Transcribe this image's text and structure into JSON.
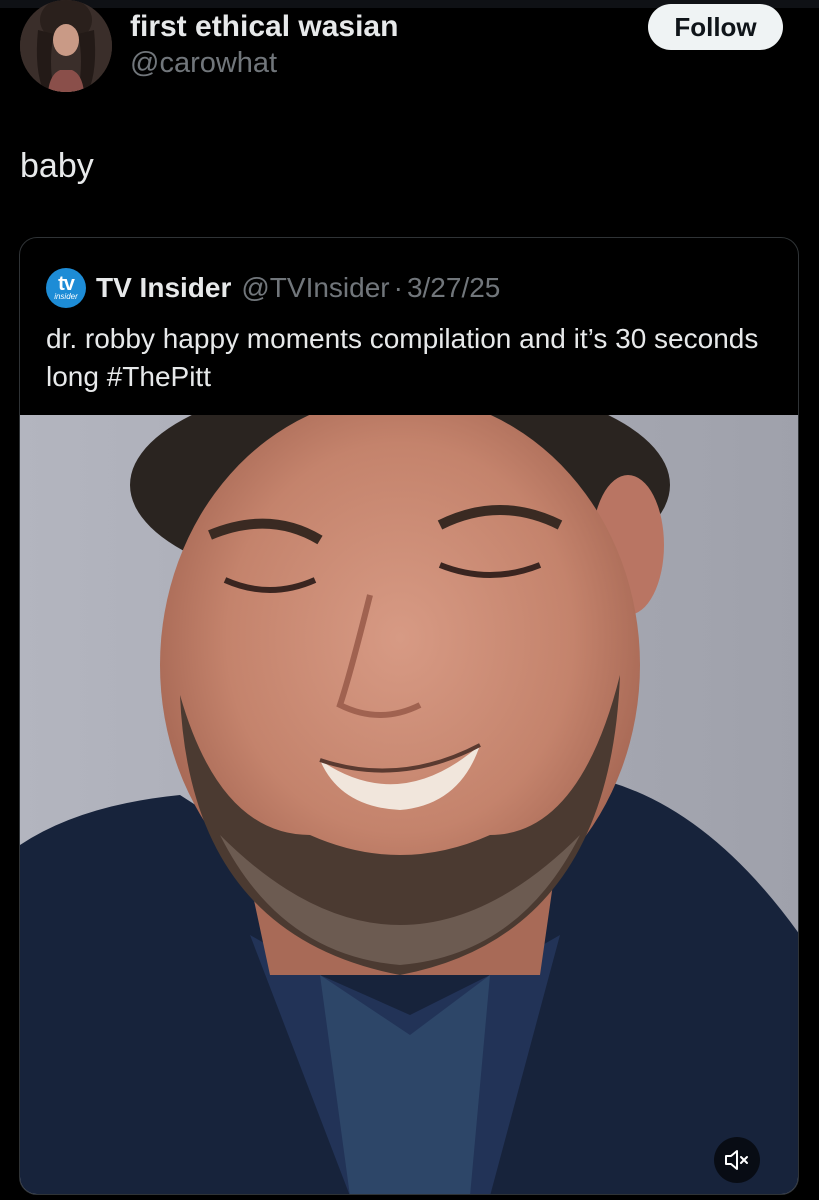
{
  "author": {
    "display_name": "first ethical wasian",
    "handle": "@carowhat",
    "avatar_icon": "profile-photo"
  },
  "follow_button": {
    "label": "Follow"
  },
  "tweet": {
    "text": "baby"
  },
  "quoted_tweet": {
    "logo": {
      "icon": "tv-insider-logo",
      "tv": "tv",
      "insider": "insider"
    },
    "display_name": "TV Insider",
    "handle": "@TVInsider",
    "separator": "·",
    "date": "3/27/25",
    "text": "dr. robby happy moments compilation and it’s 30 seconds long #ThePitt",
    "media": {
      "type": "video",
      "muted": true,
      "mute_icon": "speaker-muted-icon"
    }
  },
  "colors": {
    "background": "#000000",
    "text": "#e7e9ea",
    "secondary_text": "#71767b",
    "card_border": "#2f3336",
    "follow_bg": "#eff3f4",
    "logo_blue": "#1d8cd6"
  }
}
